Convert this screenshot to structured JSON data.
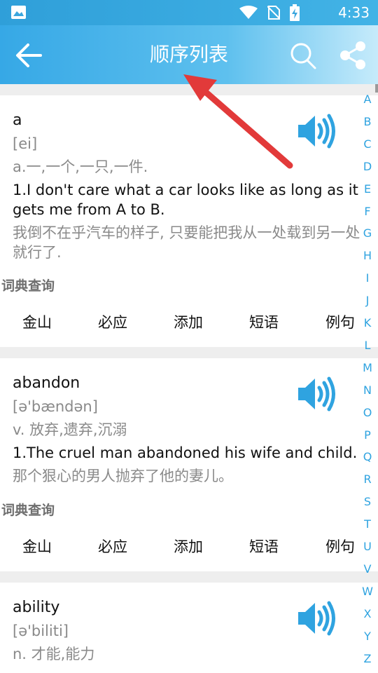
{
  "status_bar": {
    "time": "4:33",
    "icons": [
      "image-icon",
      "wifi-icon",
      "no-sim-icon",
      "battery-charging-icon"
    ]
  },
  "app_bar": {
    "title": "顺序列表",
    "back_icon": "arrow-left-icon",
    "search_icon": "search-icon",
    "share_icon": "share-icon"
  },
  "entries": [
    {
      "word": "a",
      "phonetic": "[ei]",
      "definition": "a.一,一个,一只,一件.",
      "example_en": "1.I don't care what a car looks like as long as it gets me from A to B.",
      "example_cn": "我倒不在乎汽车的样子, 只要能把我从一处载到另一处就行了.",
      "dict_label": "词典查询",
      "links": [
        "金山",
        "必应",
        "添加",
        "短语",
        "例句"
      ]
    },
    {
      "word": "abandon",
      "phonetic": "[ə'bændən]",
      "definition": "v. 放弃,遗弃,沉溺",
      "example_en": "1.The cruel man abandoned his wife and child.",
      "example_cn": "那个狠心的男人抛弃了他的妻儿。",
      "dict_label": "词典查询",
      "links": [
        "金山",
        "必应",
        "添加",
        "短语",
        "例句"
      ]
    },
    {
      "word": "ability",
      "phonetic": "[ə'biliti]",
      "definition": "n. 才能,能力",
      "example_en": "",
      "example_cn": "",
      "dict_label": "",
      "links": []
    }
  ],
  "alphabet_index": [
    "A",
    "B",
    "C",
    "D",
    "E",
    "F",
    "G",
    "H",
    "I",
    "J",
    "K",
    "L",
    "M",
    "N",
    "O",
    "P",
    "Q",
    "R",
    "S",
    "T",
    "U",
    "V",
    "W",
    "X",
    "Y",
    "Z"
  ],
  "colors": {
    "accent": "#2fa3e0",
    "appbar_start": "#36a8e6",
    "annotation_arrow": "#e23a3a"
  }
}
